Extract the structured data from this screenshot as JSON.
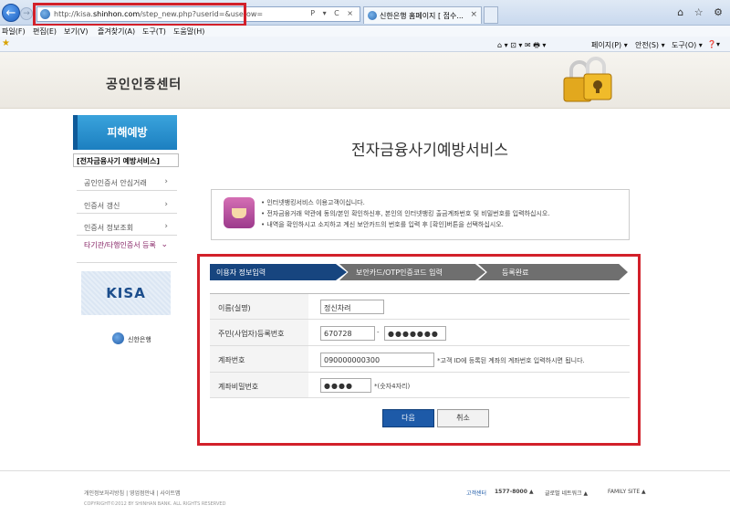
{
  "browser": {
    "url_prefix": "http://kisa.",
    "url_domain": "shinhon.com",
    "url_path": "/step_new.php?userid=&userow=",
    "addr_controls": "P ▾ C ×",
    "tab_title": "신한은행 홈페이지 [ 접수...",
    "tab_close": "×",
    "menu": [
      "파일(F)",
      "편집(E)",
      "보기(V)",
      "즐겨찾기(A)",
      "도구(T)",
      "도움말(H)"
    ],
    "commands": [
      "페이지(P) ▾",
      "안전(S) ▾",
      "도구(O) ▾",
      "❓▾"
    ],
    "right_icons": "⌂ ☆ ⚙"
  },
  "header": {
    "title": "공인인증센터"
  },
  "sidebar": {
    "section_title": "피해예방",
    "active_item": "[전자금융사기 예방서비스]",
    "items": [
      {
        "label": "공인인증서 안심거래",
        "arrow": "›"
      },
      {
        "label": "인증서 갱신",
        "arrow": "›"
      },
      {
        "label": "인증서 정보조회",
        "arrow": "›"
      },
      {
        "label": "타기관/타행인증서 등록",
        "arrow": "⌄"
      }
    ],
    "kisa_logo": "KISA",
    "bank_logo": "신한은행"
  },
  "main": {
    "title": "전자금융사기예방서비스",
    "info_lines": [
      "• 인터넷뱅킹서비스 이용고객이십니다.",
      "• 전자금융거래 약관에 동의/본인 확인하신후, 본인의 인터넷뱅킹 출금계좌번호 및 비밀번호를 입력하십시오.",
      "• 내역을 확인하시고 소지하고 계신 보안카드의 번호를 입력 후 [확인]버튼을 선택하십시오."
    ],
    "steps": [
      "이용자 정보입력",
      "보안카드/OTP인증코드 입력",
      "등록완료"
    ],
    "form": {
      "name_label": "이름(실명)",
      "name_value": "정신차려",
      "rrn_label": "주민(사업자)등록번호",
      "rrn_front": "670728",
      "rrn_sep": "-",
      "rrn_back": "●●●●●●●",
      "account_label": "계좌번호",
      "account_value": "090000000300",
      "account_hint": "*고객 ID에 등록된 계좌의 계좌번호 입력하시면 됩니다.",
      "pw_label": "계좌비밀번호",
      "pw_value": "●●●●",
      "pw_hint": "*(숫자4자리)"
    },
    "next_button": "다음",
    "cancel_button": "취소"
  },
  "footer": {
    "links": "개인정보처리방침 | 영업점안내 | 사이트맵",
    "copyright": "COPYRIGHT©2012 BY SHINHAN BANK. ALL RIGHTS RESERVED",
    "call_center_label": "고객센터",
    "call_center_number": "1577-8000 ▲",
    "global_network": "글로벌 네트워크 ▲",
    "family_site": "FAMILY SITE ▲"
  }
}
